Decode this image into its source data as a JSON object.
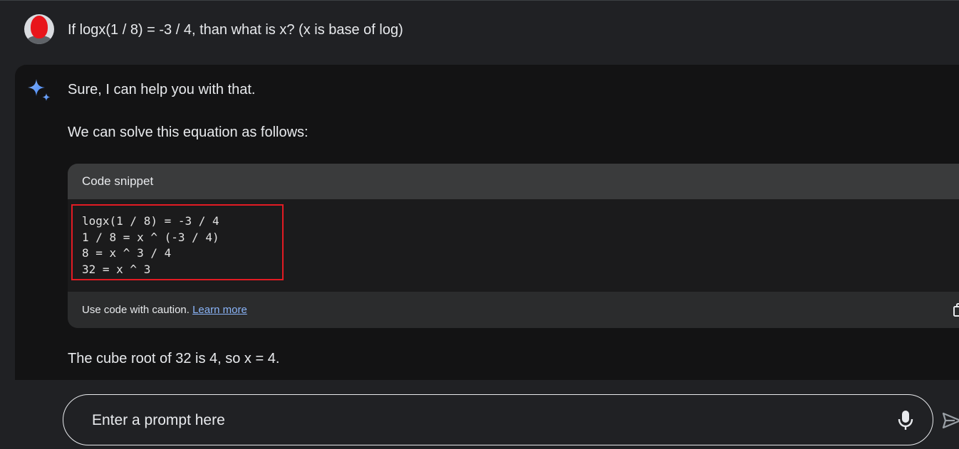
{
  "user_prompt": {
    "text": "If logx(1 / 8) = -3 / 4, than what is x? (x is base of log)"
  },
  "response": {
    "intro": "Sure, I can help you with that.",
    "lead": "We can solve this equation as follows:",
    "code_block": {
      "title": "Code snippet",
      "lines": [
        "logx(1 / 8) = -3 / 4",
        "1 / 8 = x ^ (-3 / 4)",
        "8 = x ^ 3 / 4",
        "32 = x ^ 3"
      ],
      "caution_text": "Use code with caution.",
      "learn_more_label": "Learn more"
    },
    "conclusion": "The cube root of 32 is 4, so x = 4."
  },
  "prompt_bar": {
    "placeholder": "Enter a prompt here",
    "value": ""
  },
  "icons": {
    "assistant": "sparkle-icon",
    "copy": "copy-icon",
    "mic": "microphone-icon",
    "send": "send-icon"
  },
  "colors": {
    "page_bg": "#202124",
    "response_bg": "#131314",
    "accent_blue": "#8ab4f8",
    "highlight_red": "#e31b23",
    "text": "#e8eaed"
  }
}
